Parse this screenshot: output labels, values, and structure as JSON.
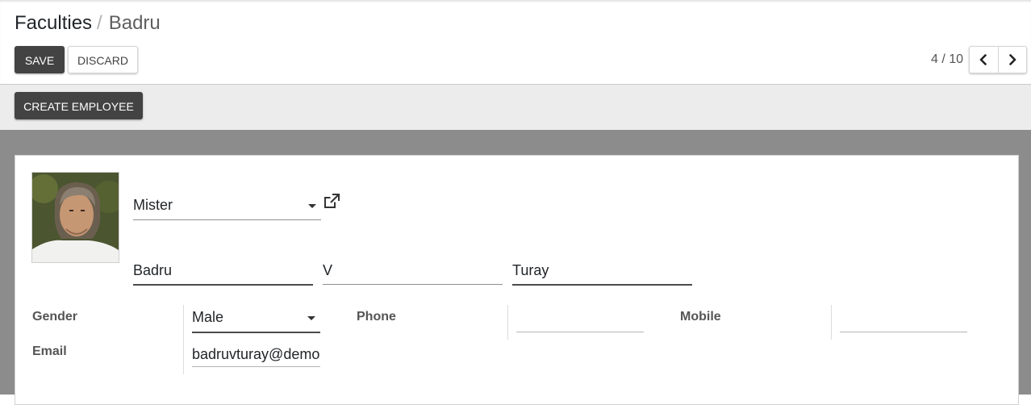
{
  "breadcrumb": {
    "parent": "Faculties",
    "separator": "/",
    "current": "Badru"
  },
  "toolbar": {
    "save_label": "SAVE",
    "discard_label": "DISCARD"
  },
  "pager": {
    "value": "4 / 10",
    "prev_icon": "chevron-left-icon",
    "next_icon": "chevron-right-icon"
  },
  "statusbar": {
    "create_employee_label": "CREATE EMPLOYEE"
  },
  "form": {
    "avatar_icon": "person-photo",
    "title": {
      "value": "Mister"
    },
    "external_link_icon": "external-link-icon",
    "first_name": "Badru",
    "middle_name": "V",
    "last_name": "Turay",
    "gender": {
      "label": "Gender",
      "value": "Male"
    },
    "email": {
      "label": "Email",
      "value": "badruvturay@demo"
    },
    "phone": {
      "label": "Phone",
      "value": ""
    },
    "mobile": {
      "label": "Mobile",
      "value": ""
    }
  },
  "colors": {
    "dark_button": "#434343",
    "sheet_background": "#8c8c8c",
    "statusbar": "#ececec"
  }
}
